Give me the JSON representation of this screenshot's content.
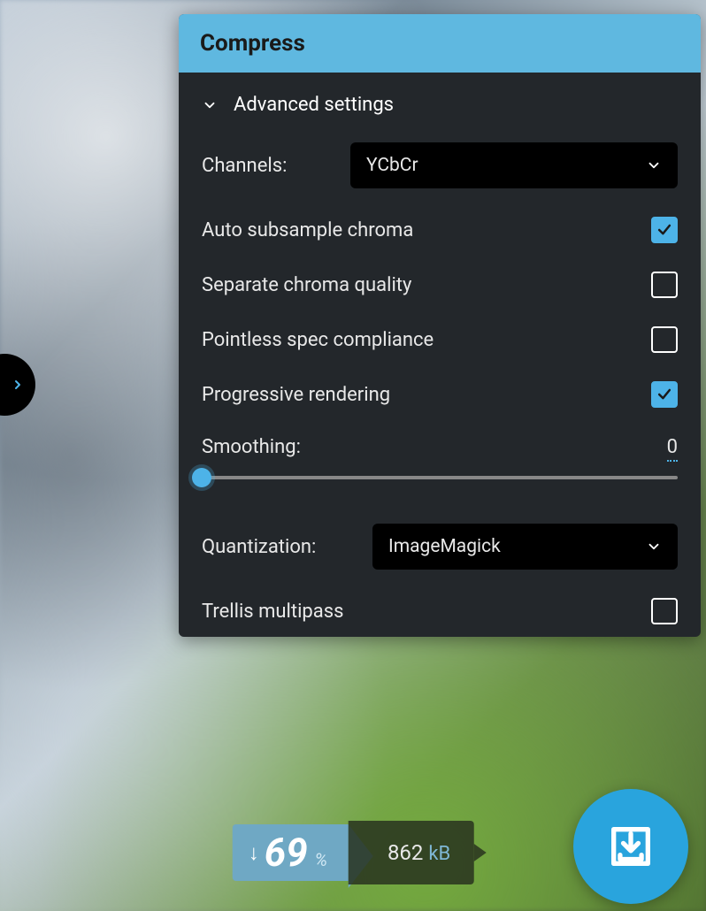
{
  "panel": {
    "title": "Compress",
    "advanced_label": "Advanced settings"
  },
  "channels": {
    "label": "Channels:",
    "value": "YCbCr"
  },
  "options": {
    "auto_subsample": {
      "label": "Auto subsample chroma",
      "checked": true
    },
    "separate_chroma": {
      "label": "Separate chroma quality",
      "checked": false
    },
    "pointless_spec": {
      "label": "Pointless spec compliance",
      "checked": false
    },
    "progressive": {
      "label": "Progressive rendering",
      "checked": true
    },
    "trellis": {
      "label": "Trellis multipass",
      "checked": false
    }
  },
  "smoothing": {
    "label": "Smoothing:",
    "value": "0"
  },
  "quantization": {
    "label": "Quantization:",
    "value": "ImageMagick"
  },
  "result": {
    "percent": "69",
    "percent_symbol": "%",
    "size_value": "862",
    "size_unit": "kB"
  },
  "colors": {
    "accent": "#4db3e8",
    "header": "#5fb8e0",
    "download": "#29a4dd"
  }
}
